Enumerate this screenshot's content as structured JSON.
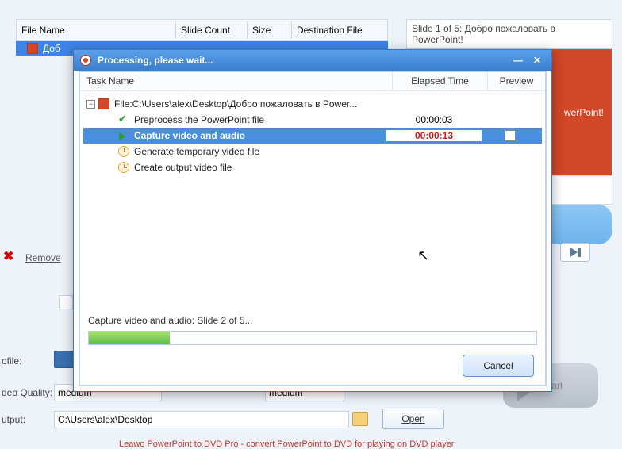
{
  "bg": {
    "headers": {
      "file_name": "File Name",
      "slide_count": "Slide Count",
      "size": "Size",
      "dest": "Destination File"
    },
    "row": {
      "file": "Доб"
    },
    "remove": "Remove",
    "profile_label": "ofile:",
    "video_quality_label": "deo Quality:",
    "video_quality_value": "medium",
    "audio_quality_value": "medium",
    "output_label": "utput:",
    "output_value": "C:\\Users\\alex\\Desktop",
    "open_btn": "Open",
    "start": "Start",
    "footer": "Leawo PowerPoint to DVD Pro - convert PowerPoint to DVD for playing on DVD player"
  },
  "preview": {
    "title": "Slide 1 of 5: Добро пожаловать в PowerPoint!",
    "slide_text": "werPoint!"
  },
  "dialog": {
    "title": "Processing, please wait...",
    "headers": {
      "task": "Task Name",
      "elapsed": "Elapsed Time",
      "preview": "Preview"
    },
    "root": "File:C:\\Users\\alex\\Desktop\\Добро пожаловать в Power...",
    "tasks": [
      {
        "name": "Preprocess the PowerPoint file",
        "elapsed": "00:00:03",
        "status": "done"
      },
      {
        "name": "Capture video and audio",
        "elapsed": "00:00:13",
        "status": "active"
      },
      {
        "name": "Generate temporary video file",
        "elapsed": "",
        "status": "pending"
      },
      {
        "name": "Create output video file",
        "elapsed": "",
        "status": "pending"
      }
    ],
    "status": "Capture video and audio: Slide 2 of 5...",
    "cancel": "Cancel"
  }
}
